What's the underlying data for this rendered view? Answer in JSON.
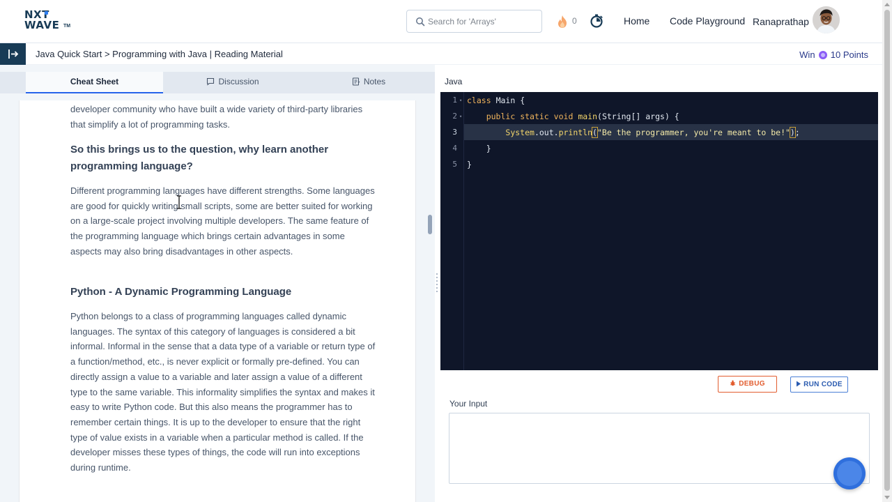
{
  "header": {
    "logo_line1": "NXT",
    "logo_line2": "WAVE",
    "logo_tm": "TM",
    "search_placeholder": "Search for 'Arrays'",
    "streak_count": "0",
    "nav_home": "Home",
    "nav_playground": "Code Playground",
    "username": "Ranaprathap"
  },
  "breadcrumb": {
    "text": "Java Quick Start > Programming with Java | Reading Material",
    "win_label": "Win",
    "win_points": "10 Points"
  },
  "tabs": {
    "cheat_sheet": "Cheat Sheet",
    "discussion": "Discussion",
    "notes": "Notes"
  },
  "article": {
    "p0": "developer community who have built a wide variety of third-party libraries that simplify a lot of programming tasks.",
    "h1": "So this brings us to the question, why learn another programming language?",
    "p1": "Different programming languages have different strengths. Some languages are good for quickly writing small scripts, some are better suited for working on a large-scale project involving multiple developers. The same feature of the programming language which brings certain advantages in some aspects may also bring disadvantages in other aspects.",
    "h2": "Python - A Dynamic Programming Language",
    "p2": "Python belongs to a class of programming languages called dynamic languages. The syntax of this category of languages is considered a bit informal. Informal in the sense that a data type of a variable or return type of a function/method, etc., is never explicit or formally pre-defined. You can directly assign a value to a variable and later assign a value of a different type to the same variable. This informality simplifies the syntax and makes it easy to write Python code. But this also means the programmer has to remember certain things. It is up to the developer to ensure that the right type of value exists in a variable when a particular method is called. If the developer misses these types of things, the code will run into exceptions during runtime."
  },
  "editor": {
    "language": "Java",
    "line_numbers": [
      "1",
      "2",
      "3",
      "4",
      "5"
    ],
    "active_line": 3,
    "lines": [
      "class Main {",
      "    public static void main(String[] args) {",
      "        System.out.println(\"Be the programmer, you're meant to be!\");",
      "    }",
      "}"
    ],
    "tokens": {
      "class_kw": "class",
      "class_name": "Main",
      "open_brace": "{",
      "public_kw": "public",
      "static_kw": "static",
      "void_kw": "void",
      "main_fn": "main",
      "params": "(String[] args) {",
      "system": "System",
      "out": ".out.",
      "println": "println",
      "open_paren": "(",
      "string_literal": "\"Be the programmer, you're meant to be!\"",
      "close_paren": ")",
      "semicolon": ";",
      "close_inner": "}",
      "close_outer": "}"
    }
  },
  "controls": {
    "debug_label": "DEBUG",
    "run_label": "RUN CODE",
    "input_label": "Your Input"
  },
  "colors": {
    "brand_dark": "#183b56",
    "editor_bg": "#0f1629",
    "accent_blue": "#2563eb",
    "debug_orange": "#e25c2e"
  }
}
